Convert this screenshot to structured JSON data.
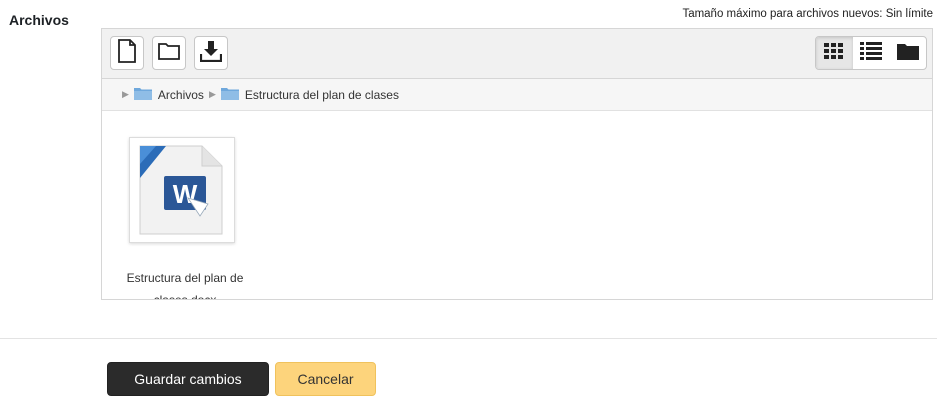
{
  "field": {
    "label": "Archivos"
  },
  "maxsize": {
    "text": "Tamaño máximo para archivos nuevos: Sin límite"
  },
  "toolbar": {
    "add_file_icon": "file-add-icon",
    "create_folder_icon": "folder-icon",
    "download_icon": "download-icon",
    "views": [
      "grid-view-icon",
      "list-view-icon",
      "tree-view-icon"
    ],
    "active_view": "grid-view-icon"
  },
  "breadcrumb": {
    "items": [
      "Archivos",
      "Estructura del plan de clases"
    ]
  },
  "files": [
    {
      "name": "Estructura del plan de clases.docx",
      "type": "word-document-icon"
    }
  ],
  "buttons": {
    "save": "Guardar cambios",
    "cancel": "Cancelar"
  },
  "colors": {
    "save_bg": "#2b2b2b",
    "cancel_bg": "#fdd47c",
    "folder": "#6fa8dc",
    "word_blue": "#2b5797"
  }
}
